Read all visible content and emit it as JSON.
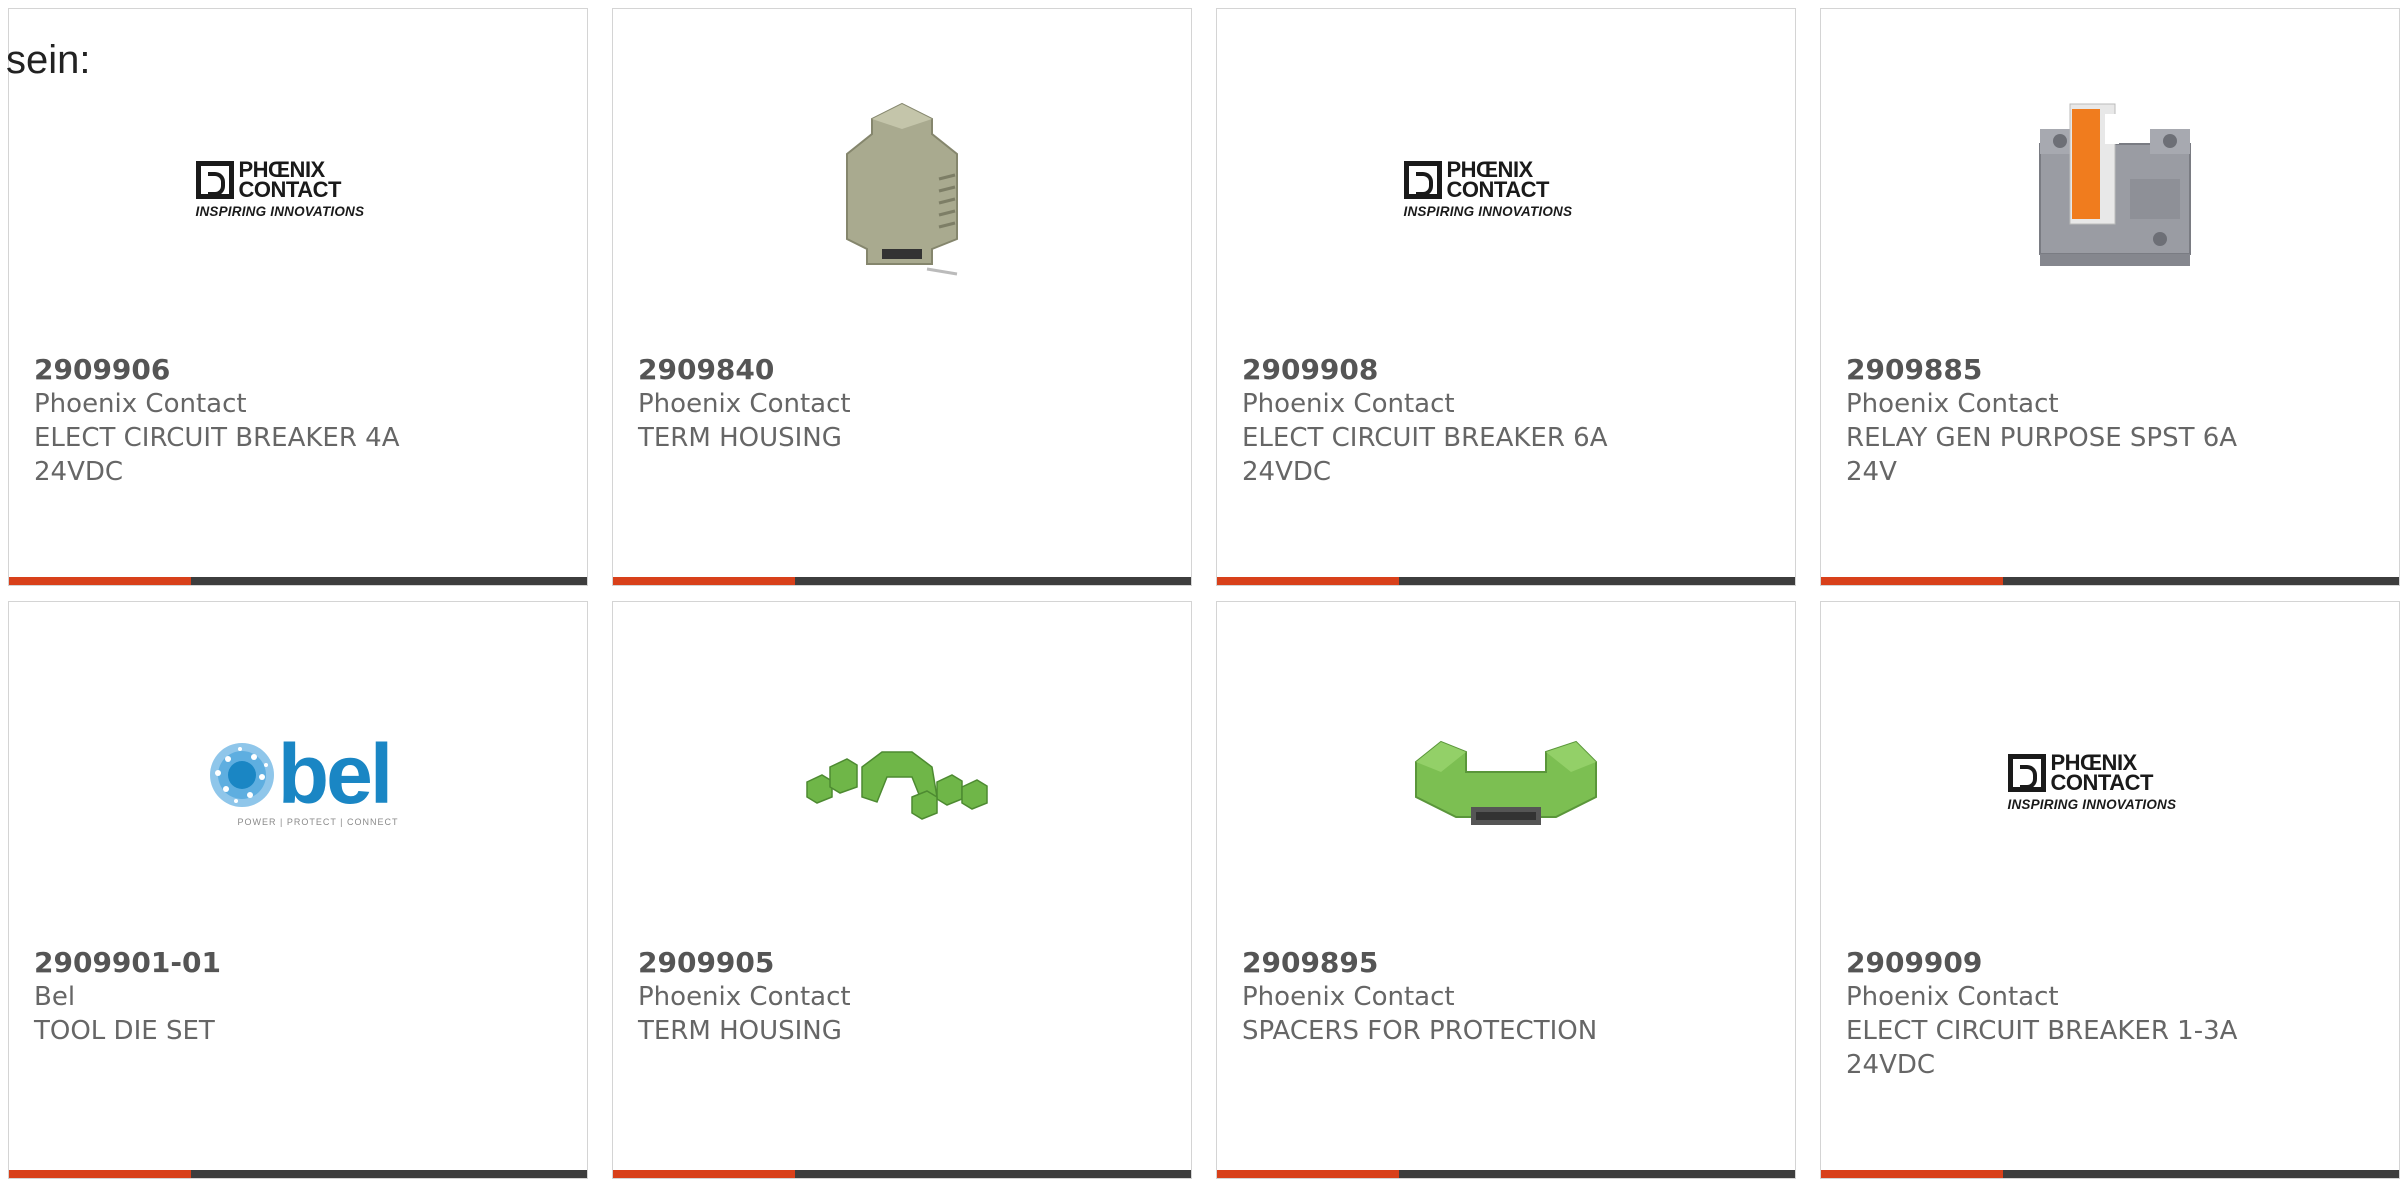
{
  "intro_text": "sein:",
  "logo_text": {
    "phoenix_line1": "PHŒNIX",
    "phoenix_line2": "CONTACT",
    "phoenix_tagline": "INSPIRING INNOVATIONS",
    "bel_word": "bel",
    "bel_tagline": "POWER | PROTECT | CONNECT"
  },
  "colors": {
    "accent": "#d8401a",
    "bar": "#3d3d3d",
    "bel_blue": "#1a86c4",
    "housing_green": "#7cbf52"
  },
  "products": [
    {
      "part_number": "2909906",
      "manufacturer": "Phoenix Contact",
      "desc1": "ELECT CIRCUIT BREAKER 4A",
      "desc2": "24VDC",
      "image": "phoenix-contact-logo"
    },
    {
      "part_number": "2909840",
      "manufacturer": "Phoenix Contact",
      "desc1": "TERM HOUSING",
      "desc2": "",
      "image": "gray-din-housing"
    },
    {
      "part_number": "2909908",
      "manufacturer": "Phoenix Contact",
      "desc1": "ELECT CIRCUIT BREAKER 6A",
      "desc2": "24VDC",
      "image": "phoenix-contact-logo"
    },
    {
      "part_number": "2909885",
      "manufacturer": "Phoenix Contact",
      "desc1": "RELAY GEN PURPOSE SPST 6A",
      "desc2": "24V",
      "image": "relay-module"
    },
    {
      "part_number": "2909901-01",
      "manufacturer": "Bel",
      "desc1": "TOOL DIE SET",
      "desc2": "",
      "image": "bel-logo"
    },
    {
      "part_number": "2909905",
      "manufacturer": "Phoenix Contact",
      "desc1": "TERM HOUSING",
      "desc2": "",
      "image": "green-housing-parts"
    },
    {
      "part_number": "2909895",
      "manufacturer": "Phoenix Contact",
      "desc1": "SPACERS FOR PROTECTION",
      "desc2": "",
      "image": "green-spacer"
    },
    {
      "part_number": "2909909",
      "manufacturer": "Phoenix Contact",
      "desc1": "ELECT CIRCUIT BREAKER 1-3A",
      "desc2": "24VDC",
      "image": "phoenix-contact-logo"
    }
  ]
}
